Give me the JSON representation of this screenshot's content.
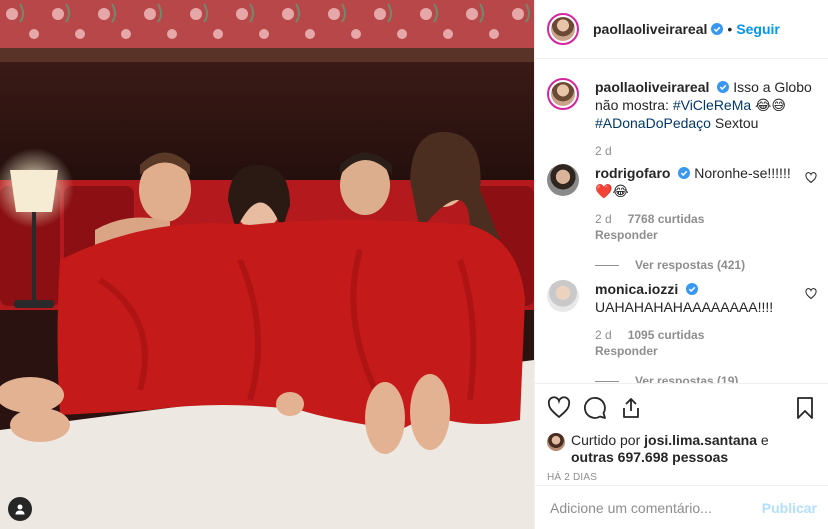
{
  "post": {
    "author": "paollaoliveirareal",
    "follow_label": "Seguir",
    "separator": "•",
    "caption": {
      "text_before": "Isso a Globo não mostra: ",
      "hashtag1": "#ViCleReMa",
      "emoji1": " 😂😅",
      "hashtag2": "#ADonaDoPedaço",
      "text_after": " Sextou"
    },
    "caption_age": "2 d"
  },
  "comments": [
    {
      "user": "rodrigofaro",
      "text": "Noronhe-se!!!!!!",
      "emoji": "❤️😂",
      "age": "2 d",
      "likes": "7768 curtidas",
      "reply": "Responder",
      "more_replies": "Ver respostas (421)"
    },
    {
      "user": "monica.iozzi",
      "text": "UAHAHAHAHAAAAAAAA!!!!",
      "age": "2 d",
      "likes": "1095 curtidas",
      "reply": "Responder",
      "more_replies": "Ver respostas (19)"
    }
  ],
  "likes": {
    "prefix": "Curtido por ",
    "user": "josi.lima.santana",
    "middle": " e ",
    "others": "outras 697.698 pessoas"
  },
  "timestamp": "HÁ 2 DIAS",
  "add_comment": {
    "placeholder": "Adicione um comentário...",
    "publish_label": "Publicar"
  },
  "icons": {
    "like": "heart-icon",
    "comment": "comment-icon",
    "share": "share-icon",
    "save": "bookmark-icon",
    "tag": "user-tag-icon",
    "verified": "verified-badge-icon"
  },
  "colors": {
    "link_blue": "#0095f6",
    "verified_blue": "#3897f0",
    "secondary_text": "#8e8e8e",
    "blanket_red": "#c41a1a"
  }
}
